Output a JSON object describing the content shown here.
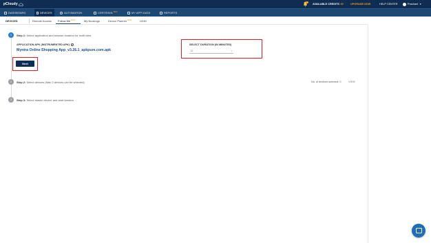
{
  "brand": {
    "logo_text": "pCloudy"
  },
  "topbar": {
    "credits_label": "AVAILABLE CREDITS",
    "credits_value": "19",
    "upgrade_label": "UPGRADE NOW",
    "help_label": "HELP CENTER",
    "user_name": "Prashant"
  },
  "nav": {
    "items": [
      {
        "label": "DASHBOARD",
        "icon": "cloud-icon",
        "new": ""
      },
      {
        "label": "DEVICES",
        "icon": "mobile-icon",
        "new": ""
      },
      {
        "label": "AUTOMATION",
        "icon": "gear-icon",
        "new": ""
      },
      {
        "label": "CERTIFAYA",
        "icon": "bot-icon",
        "new": "NEW"
      },
      {
        "label": "MY APP/ DATA",
        "icon": "folder-icon",
        "new": ""
      },
      {
        "label": "REPORTS",
        "icon": "report-icon",
        "new": ""
      }
    ]
  },
  "subnav": {
    "title": "DEVICES",
    "items": [
      {
        "label": "Remote Access",
        "new": ""
      },
      {
        "label": "Follow Me",
        "new": "NEW"
      },
      {
        "label": "My Bookings",
        "new": ""
      },
      {
        "label": "Device Planner",
        "new": "NEW"
      },
      {
        "label": "UDID",
        "new": ""
      }
    ]
  },
  "steps": [
    {
      "number": "1",
      "label": "Step 1:",
      "text": "Select application and session duration for multi view"
    },
    {
      "number": "2",
      "label": "Step 2:",
      "text": "Select devices (Max 2 devices can be selected)"
    },
    {
      "number": "3",
      "label": "Step 3:",
      "text": "Select master device and start session"
    }
  ],
  "form": {
    "apk_label": "APPLICATION APK (INSTRUMENTED APK)",
    "apk_value": "Myntra Online Shopping App_v3.26.1_apkpure.com.apk",
    "duration_label": "SELECT DURATION (IN MINUTES)",
    "duration_value": "15",
    "next_label": "Next"
  },
  "device_selection": {
    "label": "No. of devices selected:",
    "count": "0",
    "view_label": "VIEW"
  },
  "colors": {
    "topbar": "#0f2d52",
    "navbar": "#1d4872",
    "accent": "#f39c12",
    "highlight": "#e41e1e",
    "step_active": "#2d7fd0"
  }
}
